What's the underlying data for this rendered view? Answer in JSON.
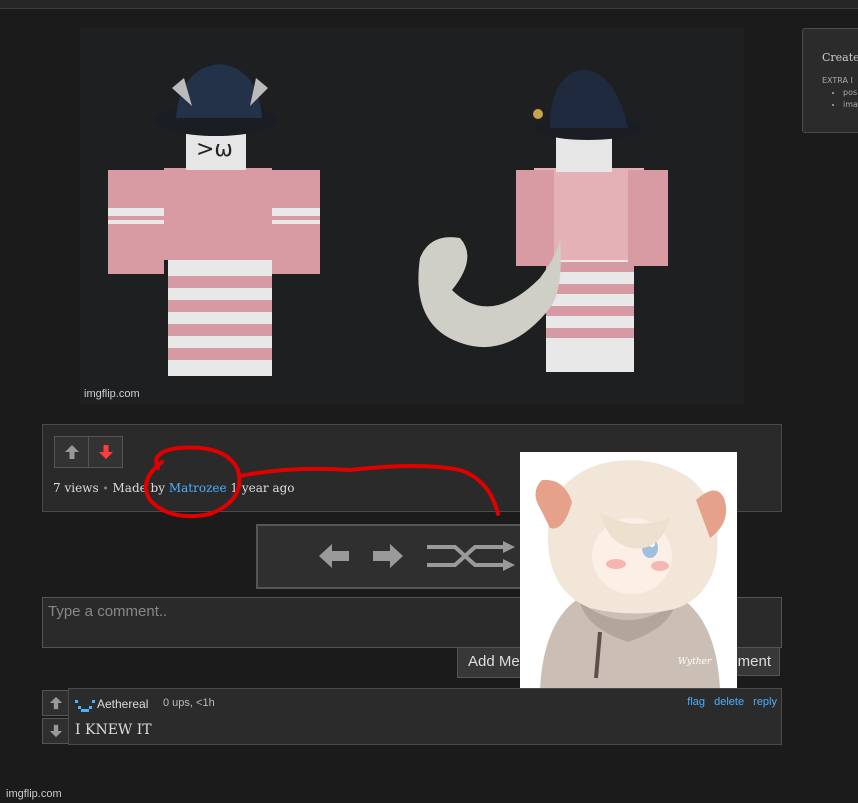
{
  "image": {
    "watermark": "imgflip.com"
  },
  "side_panel": {
    "title": "Create",
    "subtitle": "EXTRA I",
    "items": [
      "pos",
      "ima"
    ]
  },
  "info": {
    "views": "7 views",
    "made_by_prefix": "Made by",
    "author": "Matrozee",
    "time": "1 year ago"
  },
  "comment_box": {
    "placeholder": "Type a comment..",
    "add_meme_label": "Add Me",
    "post_label": "ment"
  },
  "anime_signature": "Wyther",
  "comment": {
    "username": "Aethereal",
    "meta": "0 ups, <1h",
    "actions": {
      "flag": "flag",
      "delete": "delete",
      "reply": "reply"
    },
    "text": "I KNEW IT"
  },
  "footer": {
    "watermark": "imgflip.com"
  },
  "colors": {
    "link": "#4ab1ff",
    "downvote": "#ff3b3b",
    "annotation": "#e00000"
  }
}
